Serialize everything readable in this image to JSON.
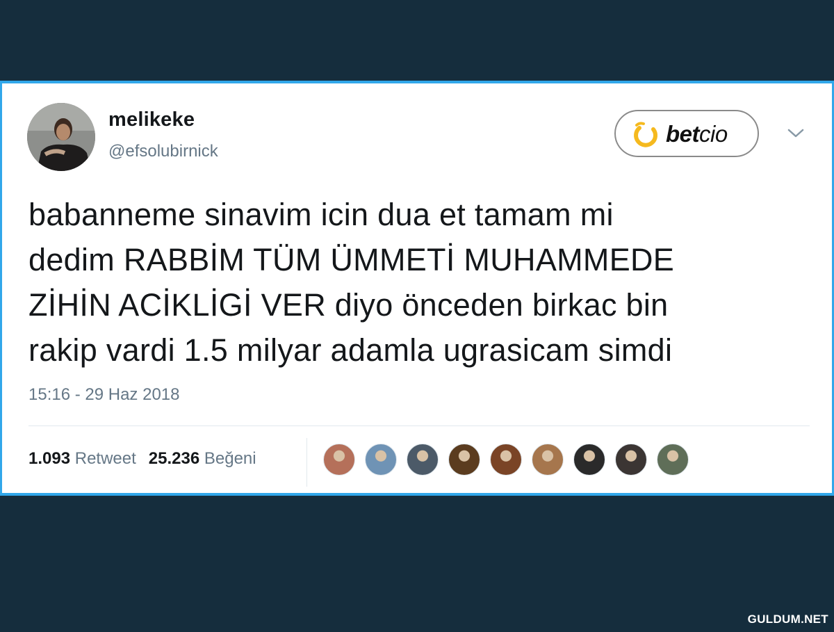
{
  "user": {
    "display_name": "melikeke",
    "handle": "@efsolubirnick"
  },
  "brand_badge": {
    "name_bold": "bet",
    "name_light": "cio",
    "accent_color": "#f5b91e"
  },
  "tweet": {
    "lines": [
      "babanneme sinavim icin dua et tamam mi",
      "dedim RABBİM TÜM ÜMMETİ MUHAMMEDE",
      "ZİHİN ACİKLİGİ VER diyo önceden birkac bin",
      "rakip vardi 1.5 milyar adamla ugrasicam simdi"
    ],
    "timestamp": "15:16 - 29 Haz 2018"
  },
  "stats": {
    "retweet_count": "1.093",
    "retweet_label": "Retweet",
    "like_count": "25.236",
    "like_label": "Beğeni"
  },
  "likers": [
    {
      "color": "#b5705a"
    },
    {
      "color": "#6f93b5"
    },
    {
      "color": "#4c5a68"
    },
    {
      "color": "#5b3c1f"
    },
    {
      "color": "#7a4426"
    },
    {
      "color": "#a6764d"
    },
    {
      "color": "#2a2a2a"
    },
    {
      "color": "#3b3533"
    },
    {
      "color": "#5f6e58"
    }
  ],
  "colors": {
    "background": "#152d3d",
    "card_border": "#31a7ea",
    "secondary_text": "#657786"
  },
  "watermark": "GULDUM.NET"
}
